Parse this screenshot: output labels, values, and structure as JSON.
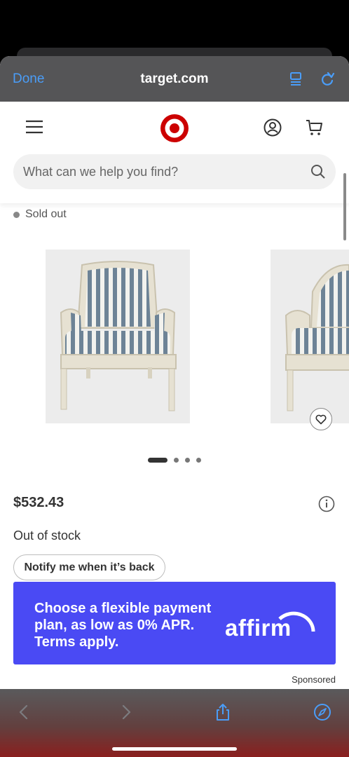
{
  "safari": {
    "done_label": "Done",
    "url": "target.com"
  },
  "header": {
    "search_placeholder": "What can we help you find?"
  },
  "product": {
    "availability_badge": "Sold out",
    "price": "$532.43",
    "stock_status": "Out of stock",
    "notify_button_label": "Notify me when it’s back",
    "carousel_total": 4,
    "carousel_active": 1
  },
  "ad": {
    "message": "Choose a flexible payment plan, as low as 0% APR. Terms apply.",
    "brand": "affirm",
    "sponsored_label": "Sponsored"
  },
  "colors": {
    "safari_link": "#4a9df8",
    "target_red": "#cc0000",
    "affirm_banner": "#4a4af4"
  },
  "icons": [
    "menu-icon",
    "target-logo",
    "account-icon",
    "cart-icon",
    "search-icon",
    "heart-icon",
    "info-icon",
    "back-icon",
    "forward-icon",
    "share-icon",
    "compass-icon",
    "reader-icon",
    "reload-icon"
  ]
}
